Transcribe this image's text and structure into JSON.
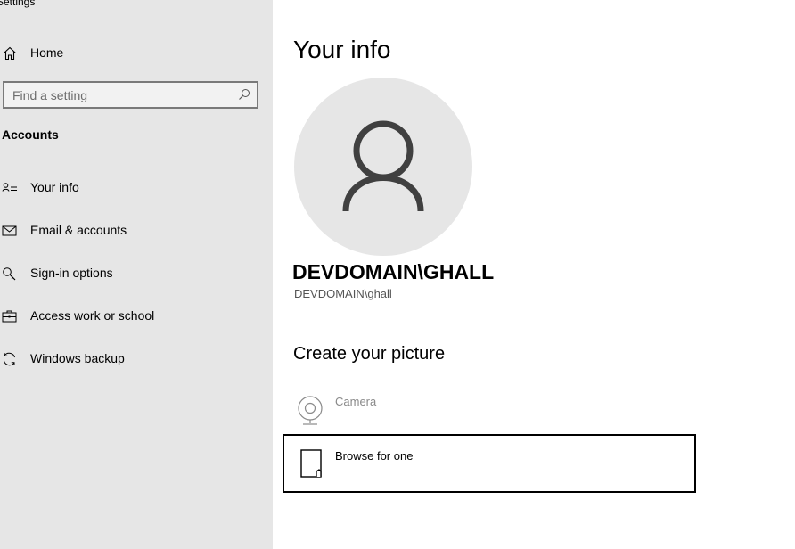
{
  "window": {
    "title": "Settings"
  },
  "sidebar": {
    "home_label": "Home",
    "search": {
      "placeholder": "Find a setting",
      "value": ""
    },
    "section_title": "Accounts",
    "items": [
      {
        "label": "Your info",
        "icon": "contact-card-icon",
        "selected": true
      },
      {
        "label": "Email & accounts",
        "icon": "mail-icon"
      },
      {
        "label": "Sign-in options",
        "icon": "key-icon"
      },
      {
        "label": "Access work or school",
        "icon": "briefcase-icon"
      },
      {
        "label": "Windows backup",
        "icon": "sync-icon"
      }
    ]
  },
  "main": {
    "title": "Your info",
    "avatar_icon": "person-icon",
    "user_display": "DEVDOMAIN\\GHALL",
    "user_sub": "DEVDOMAIN\\ghall",
    "create_picture": {
      "heading": "Create your picture",
      "camera_label": "Camera",
      "browse_label": "Browse for one"
    }
  },
  "colors": {
    "sidebar_bg": "#e6e6e6",
    "avatar_bg": "#e6e6e6",
    "avatar_fg": "#404040",
    "disabled_text": "#8a8a8a"
  }
}
